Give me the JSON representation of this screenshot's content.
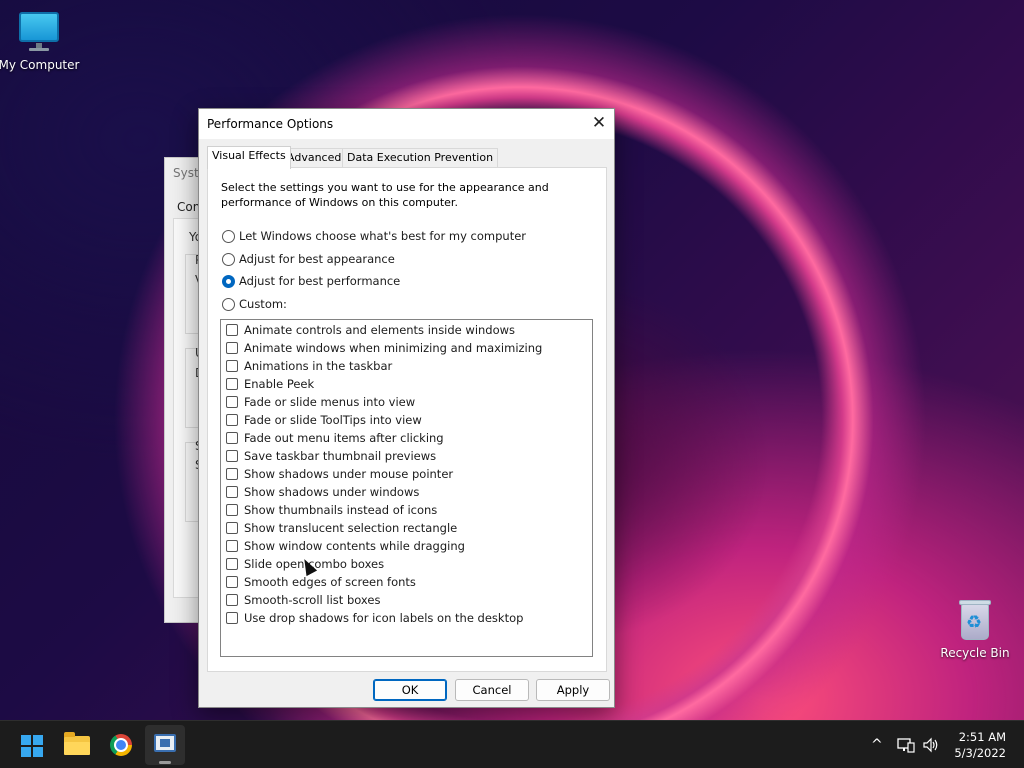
{
  "desktop": {
    "icons": [
      {
        "label": "My Computer",
        "icon": "computer-icon"
      },
      {
        "label": "Recycle Bin",
        "icon": "recycle-bin-icon"
      }
    ]
  },
  "background_window": {
    "title": "Syste",
    "tab": "Com",
    "fragments": [
      "Yo",
      "P",
      "V",
      "U",
      "D",
      "S",
      "S"
    ]
  },
  "dialog": {
    "title": "Performance Options",
    "tabs": [
      {
        "label": "Visual Effects",
        "active": true
      },
      {
        "label": "Advanced",
        "active": false
      },
      {
        "label": "Data Execution Prevention",
        "active": false
      }
    ],
    "description": "Select the settings you want to use for the appearance and performance of Windows on this computer.",
    "radio_options": [
      {
        "label": "Let Windows choose what's best for my computer",
        "checked": false
      },
      {
        "label": "Adjust for best appearance",
        "checked": false
      },
      {
        "label": "Adjust for best performance",
        "checked": true
      },
      {
        "label": "Custom:",
        "checked": false
      }
    ],
    "effects": [
      {
        "label": "Animate controls and elements inside windows",
        "checked": false
      },
      {
        "label": "Animate windows when minimizing and maximizing",
        "checked": false
      },
      {
        "label": "Animations in the taskbar",
        "checked": false
      },
      {
        "label": "Enable Peek",
        "checked": false
      },
      {
        "label": "Fade or slide menus into view",
        "checked": false
      },
      {
        "label": "Fade or slide ToolTips into view",
        "checked": false
      },
      {
        "label": "Fade out menu items after clicking",
        "checked": false
      },
      {
        "label": "Save taskbar thumbnail previews",
        "checked": false
      },
      {
        "label": "Show shadows under mouse pointer",
        "checked": false
      },
      {
        "label": "Show shadows under windows",
        "checked": false
      },
      {
        "label": "Show thumbnails instead of icons",
        "checked": false
      },
      {
        "label": "Show translucent selection rectangle",
        "checked": false
      },
      {
        "label": "Show window contents while dragging",
        "checked": false
      },
      {
        "label": "Slide open combo boxes",
        "checked": false
      },
      {
        "label": "Smooth edges of screen fonts",
        "checked": false
      },
      {
        "label": "Smooth-scroll list boxes",
        "checked": false
      },
      {
        "label": "Use drop shadows for icon labels on the desktop",
        "checked": false
      }
    ],
    "buttons": {
      "ok": "OK",
      "cancel": "Cancel",
      "apply": "Apply"
    }
  },
  "taskbar": {
    "apps": [
      {
        "icon": "start-icon",
        "active": false
      },
      {
        "icon": "file-explorer-icon",
        "active": false
      },
      {
        "icon": "chrome-icon",
        "active": false
      },
      {
        "icon": "system-properties-icon",
        "active": true
      }
    ],
    "tray": {
      "chevron": "^",
      "icons": [
        "network-icon",
        "volume-icon"
      ]
    },
    "time": "2:51 AM",
    "date": "5/3/2022"
  },
  "colors": {
    "accent": "#0067c0",
    "taskbar": "#1c1c1c"
  }
}
